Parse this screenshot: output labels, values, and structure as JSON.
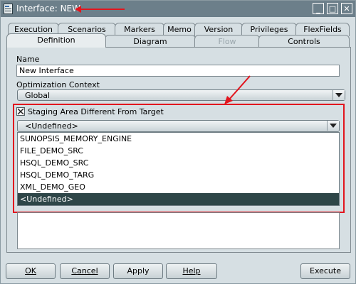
{
  "window": {
    "title": "Interface: NEW",
    "icon": "interface-icon",
    "controls": {
      "minimize": "_",
      "maximize": "□",
      "close": "✕"
    }
  },
  "tabs": {
    "back_row": [
      "Execution",
      "Scenarios",
      "Markers",
      "Memo",
      "Version",
      "Privileges",
      "FlexFields"
    ],
    "front_row": [
      "Definition",
      "Diagram",
      "Flow",
      "Controls"
    ],
    "active": "Definition",
    "disabled": [
      "Flow"
    ]
  },
  "form": {
    "name_label": "Name",
    "name_value": "New Interface",
    "optimization_label": "Optimization Context",
    "optimization_value": "Global",
    "staging_checkbox_label": "Staging Area Different From Target",
    "staging_checked": true,
    "staging_select_value": "<Undefined>",
    "staging_options": [
      "SUNOPSIS_MEMORY_ENGINE",
      "FILE_DEMO_SRC",
      "HSQL_DEMO_SRC",
      "HSQL_DEMO_TARG",
      "XML_DEMO_GEO",
      "<Undefined>"
    ],
    "highlighted_option": "<Undefined>"
  },
  "buttons": {
    "ok": "OK",
    "cancel": "Cancel",
    "apply": "Apply",
    "help": "Help",
    "execute": "Execute"
  },
  "colors": {
    "titlebar": "#6c7f8a",
    "window_bg": "#d6dfe3",
    "highlight_red": "#e2151e",
    "selected_row": "#2e4648"
  }
}
